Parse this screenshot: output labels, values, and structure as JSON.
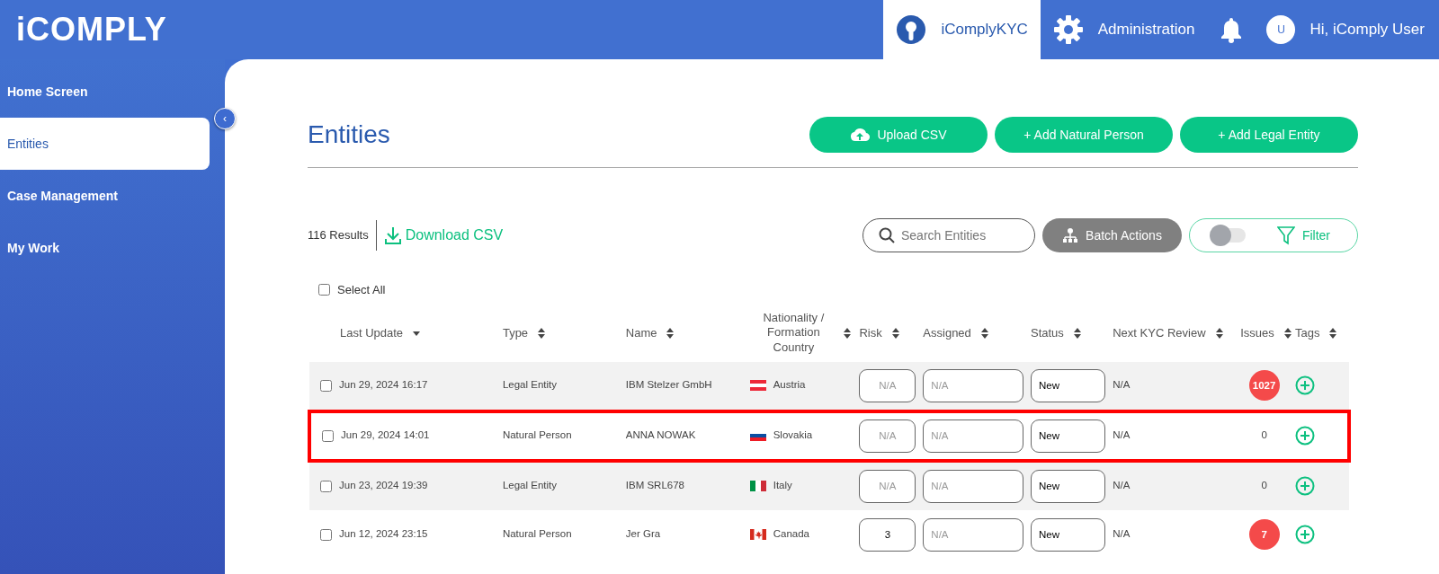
{
  "logo": {
    "text": "iCOMPLY"
  },
  "top_nav": [
    {
      "label": "iComplyKYC",
      "selected": true
    },
    {
      "label": "Administration",
      "selected": false
    }
  ],
  "user": {
    "avatar_initial": "U",
    "greeting": "Hi, iComply User"
  },
  "sidebar": {
    "items": [
      {
        "label": "Home Screen",
        "selected": false
      },
      {
        "label": "Entities",
        "selected": true
      },
      {
        "label": "Case Management",
        "selected": false
      },
      {
        "label": "My Work",
        "selected": false
      }
    ],
    "collapse_button": "‹"
  },
  "page": {
    "title": "Entities",
    "actions": [
      {
        "label": "Upload CSV"
      },
      {
        "label": "+ Add Natural Person"
      },
      {
        "label": "+ Add Legal Entity"
      }
    ]
  },
  "toolbar": {
    "results": "116 Results",
    "download": "Download CSV",
    "search": {
      "placeholder": "Search Entities"
    },
    "batch": "Batch Actions",
    "filter": {
      "label": "Filter",
      "on": false
    }
  },
  "select_all": {
    "label": "Select All",
    "checked": false
  },
  "table": {
    "columns": [
      {
        "label": "Last Update",
        "sorted": true
      },
      {
        "label": "Type",
        "sorted": false
      },
      {
        "label": "Name",
        "sorted": false
      },
      {
        "label": "Nationality / Formation Country",
        "sorted": false
      },
      {
        "label": "Risk",
        "sorted": false
      },
      {
        "label": "Assigned",
        "sorted": false
      },
      {
        "label": "Status",
        "sorted": false
      },
      {
        "label": "Next KYC Review",
        "sorted": false
      },
      {
        "label": "Issues",
        "sorted": false
      },
      {
        "label": "Tags",
        "sorted": false
      }
    ],
    "rows": [
      {
        "checked": false,
        "highlighted": false,
        "last_update": "Jun 29, 2024 16:17",
        "type": "Legal Entity",
        "name": "IBM Stelzer GmbH",
        "country": "Austria",
        "risk": {
          "placeholder": "N/A"
        },
        "assigned": {
          "placeholder": "N/A"
        },
        "status": "New",
        "next_review": "N/A",
        "issues": "1027",
        "alert": true
      },
      {
        "checked": false,
        "highlighted": true,
        "last_update": "Jun 29, 2024 14:01",
        "type": "Natural Person",
        "name": "ANNA NOWAK",
        "country": "Slovakia",
        "risk": {
          "placeholder": "N/A"
        },
        "assigned": {
          "placeholder": "N/A"
        },
        "status": "New",
        "next_review": "N/A",
        "issues": "0",
        "alert": false
      },
      {
        "checked": false,
        "highlighted": false,
        "last_update": "Jun 23, 2024 19:39",
        "type": "Legal Entity",
        "name": "IBM SRL678",
        "country": "Italy",
        "risk": {
          "placeholder": "N/A"
        },
        "assigned": {
          "placeholder": "N/A"
        },
        "status": "New",
        "next_review": "N/A",
        "issues": "0",
        "alert": false
      },
      {
        "checked": false,
        "highlighted": false,
        "last_update": "Jun 12, 2024 23:15",
        "type": "Natural Person",
        "name": "Jer Gra",
        "country": "Canada",
        "risk": {
          "value": "3"
        },
        "assigned": {
          "placeholder": "N/A"
        },
        "status": "New",
        "next_review": "N/A",
        "issues": "7",
        "alert": true
      }
    ]
  }
}
